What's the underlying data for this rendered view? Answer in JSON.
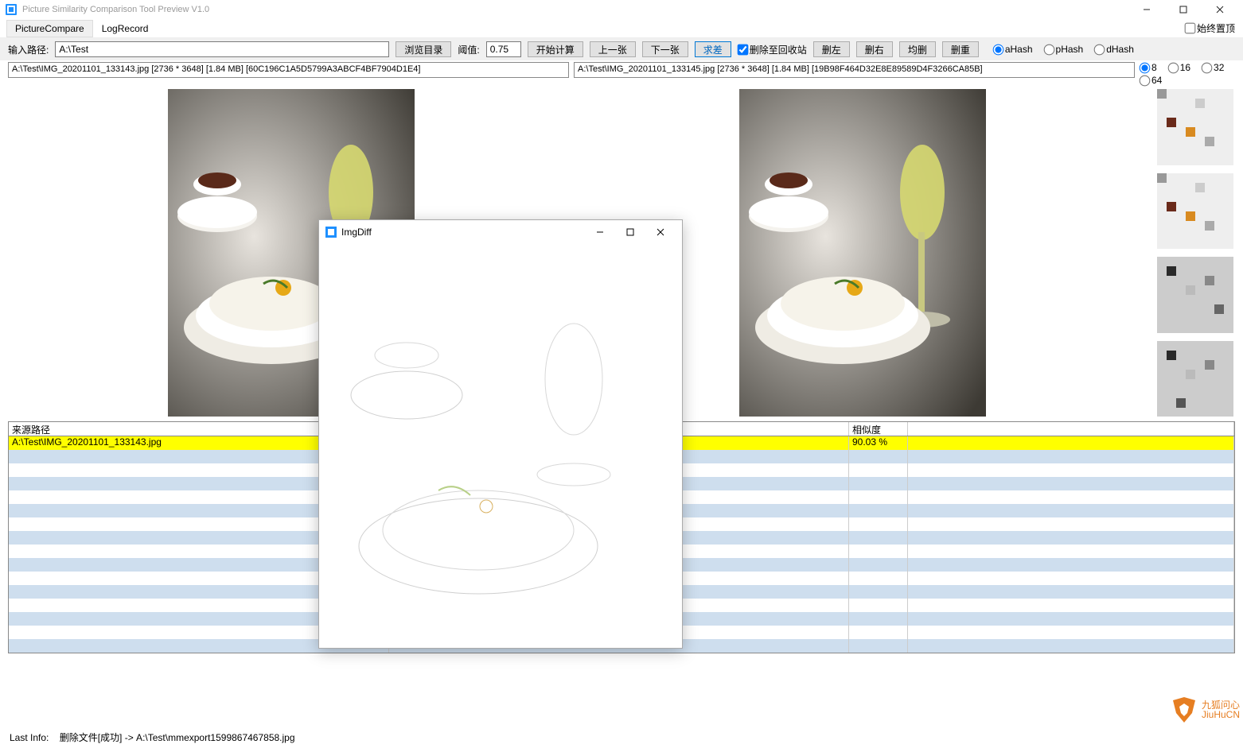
{
  "titlebar": {
    "title": "Picture Similarity Comparison Tool Preview V1.0"
  },
  "menubar": {
    "tab1": "PictureCompare",
    "tab2": "LogRecord",
    "always_top": "始终置顶"
  },
  "toolbar": {
    "input_label": "输入路径:",
    "input_value": "A:\\Test",
    "browse": "浏览目录",
    "thresh_label": "阈值:",
    "thresh_value": "0.75",
    "start": "开始计算",
    "prev": "上一张",
    "next": "下一张",
    "diff": "求差",
    "recycle": "删除至回收站",
    "del_left": "删左",
    "del_right": "删右",
    "del_both": "均删",
    "del_dup": "删重",
    "hash1": "aHash",
    "hash2": "pHash",
    "hash3": "dHash",
    "sz8": "8",
    "sz16": "16",
    "sz32": "32",
    "sz64": "64"
  },
  "info": {
    "left": "A:\\Test\\IMG_20201101_133143.jpg [2736 * 3648] [1.84 MB] [60C196C1A5D5799A3ABCF4BF7904D1E4]",
    "right": "A:\\Test\\IMG_20201101_133145.jpg [2736 * 3648] [1.84 MB] [19B98F464D32E8E89589D4F3266CA85B]"
  },
  "table": {
    "headers": {
      "source": "来源路径",
      "mid": "",
      "sim": "相似度",
      "r": ""
    },
    "row": {
      "src": "A:\\Test\\IMG_20201101_133143.jpg",
      "sim": "90.03 %"
    }
  },
  "popup": {
    "title": "ImgDiff"
  },
  "status": {
    "prefix": "Last Info:",
    "text": "删除文件[成功] -> A:\\Test\\mmexport1599867467858.jpg"
  },
  "watermark": {
    "line1": "九狐问心",
    "line2": "JiuHuCN"
  }
}
